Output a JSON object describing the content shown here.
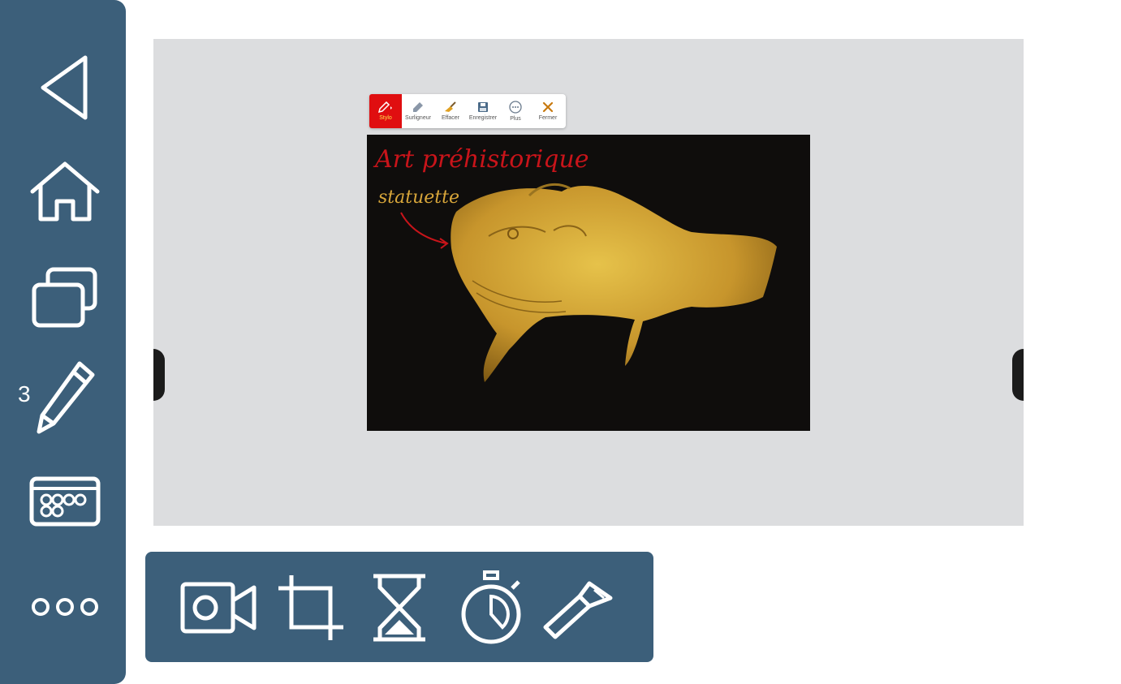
{
  "sidebar": {
    "back_icon": "triangle-back-icon",
    "home_icon": "home-icon",
    "windows_icon": "windows-icon",
    "pencil_icon": "pencil-icon",
    "pencil_badge": "3",
    "keyboard_icon": "keyboard-icon",
    "more_icon": "more-dots-icon"
  },
  "annotation_toolbar": {
    "tools": [
      {
        "label": "Stylo",
        "icon": "pen-icon",
        "active": true
      },
      {
        "label": "Surligneur",
        "icon": "highlighter-icon",
        "active": false
      },
      {
        "label": "Effacer",
        "icon": "broom-icon",
        "active": false
      },
      {
        "label": "Enregistrer",
        "icon": "save-icon",
        "active": false
      },
      {
        "label": "Plus",
        "icon": "more-icon",
        "active": false
      },
      {
        "label": "Fermer",
        "icon": "close-icon",
        "active": false
      }
    ]
  },
  "photo": {
    "annotation_title": "Art préhistorique",
    "annotation_label": "statuette",
    "title_color": "#c8141a",
    "label_color": "#d8a63a"
  },
  "bottom_toolbar": {
    "tools": [
      {
        "name": "camera",
        "icon": "video-camera-icon"
      },
      {
        "name": "crop",
        "icon": "crop-icon"
      },
      {
        "name": "timer",
        "icon": "hourglass-icon"
      },
      {
        "name": "stopwatch",
        "icon": "stopwatch-icon"
      },
      {
        "name": "spotlight",
        "icon": "flashlight-icon"
      }
    ]
  },
  "colors": {
    "panel": "#3c5f7a",
    "stage": "#dcdddf",
    "accent": "#e00e10"
  }
}
